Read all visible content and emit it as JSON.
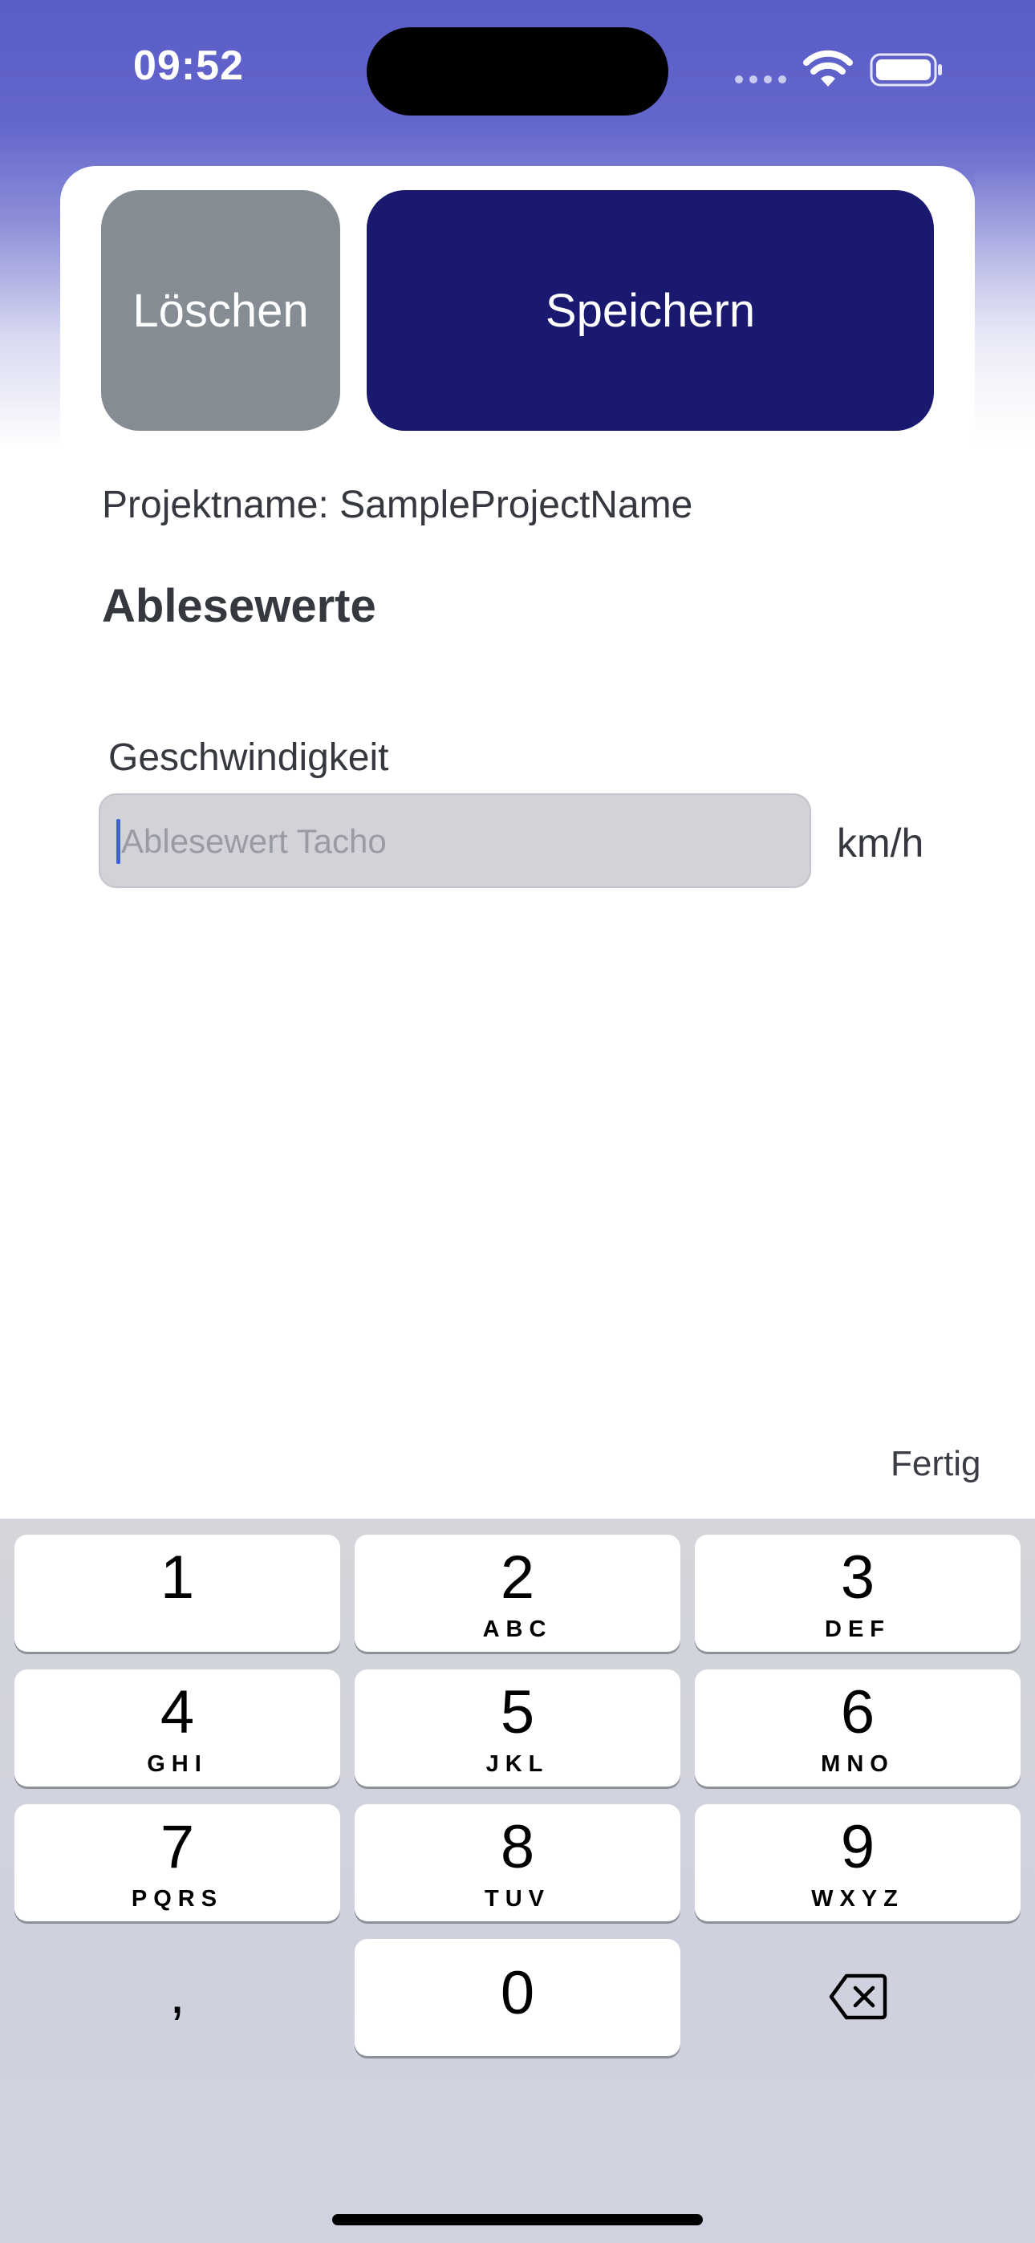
{
  "status_bar": {
    "time": "09:52",
    "icons": [
      "signal-icon",
      "wifi-icon",
      "battery-icon"
    ]
  },
  "toolbar": {
    "delete_label": "Löschen",
    "save_label": "Speichern"
  },
  "project": {
    "name_line": "Projektname: SampleProjectName"
  },
  "section": {
    "title": "Ablesewerte"
  },
  "speed_field": {
    "label": "Geschwindigkeit",
    "placeholder": "Ablesewert Tacho",
    "value": "",
    "unit": "km/h"
  },
  "keyboard_accessory": {
    "done_label": "Fertig"
  },
  "keyboard": {
    "keys": [
      {
        "digit": "1",
        "letters": ""
      },
      {
        "digit": "2",
        "letters": "ABC"
      },
      {
        "digit": "3",
        "letters": "DEF"
      },
      {
        "digit": "4",
        "letters": "GHI"
      },
      {
        "digit": "5",
        "letters": "JKL"
      },
      {
        "digit": "6",
        "letters": "MNO"
      },
      {
        "digit": "7",
        "letters": "PQRS"
      },
      {
        "digit": "8",
        "letters": "TUV"
      },
      {
        "digit": "9",
        "letters": "WXYZ"
      }
    ],
    "comma": ",",
    "zero": "0",
    "backspace_icon": "backspace-icon"
  },
  "colors": {
    "header_gradient": "#5a5cc8",
    "save_button": "#191970",
    "delete_button": "#868c93",
    "caret": "#3d5fe0"
  }
}
